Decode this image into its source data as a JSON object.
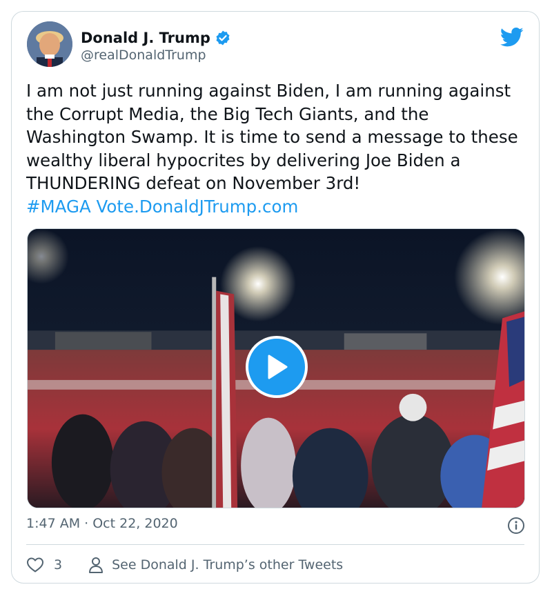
{
  "author": {
    "display_name": "Donald J. Trump",
    "handle": "@realDonaldTrump",
    "verified": true
  },
  "tweet": {
    "text_main": "I am not just running against Biden, I am running against the Corrupt Media, the Big Tech Giants, and the Washington Swamp. It is time to send a message to these wealthy liberal hypocrites by delivering Joe Biden a THUNDERING defeat on November 3rd!",
    "hashtag": "#MAGA",
    "link": "Vote.DonaldJTrump.com"
  },
  "meta": {
    "timestamp": "1:47 AM · Oct 22, 2020"
  },
  "actions": {
    "like_count": "3",
    "other_tweets_label": "See Donald J. Trump’s other Tweets"
  },
  "icons": {
    "brand": "twitter-bird-icon",
    "verified": "verified-badge-icon",
    "play": "play-icon",
    "info": "info-icon",
    "like": "heart-icon",
    "profile": "person-icon"
  },
  "colors": {
    "accent": "#1d9bf0",
    "text": "#0f1419",
    "secondary": "#536471",
    "border": "#cfd9de"
  }
}
